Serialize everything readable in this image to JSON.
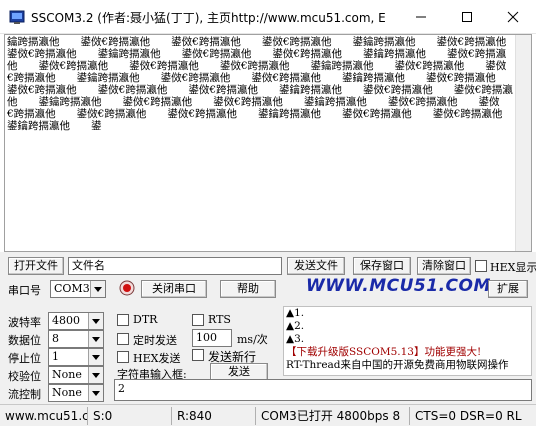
{
  "window": {
    "title": "SSCOM3.2 (作者:聂小猛(丁丁), 主页http://www.mcu51.com,  E..."
  },
  "receive": {
    "text": "鑰跨搹瀛他　　鍙傚€跨搹瀛他　　鍙傚€跨搹瀛他　　鍙傚€跨搹瀛他　　鍙鑰跨搹瀛他　　鍙傚€跨搹瀛他　　鍙傚€跨搹瀛他　　鍙鑰跨搹瀛他　　鍙傚€跨搹瀛他　　鍙傚€跨搹瀛他　　鍙鑰跨搹瀛他　　鍙傚€跨搹瀛他　　鍙傚€跨搹瀛他　　鍙傚€跨搹瀛他　　鍙傚€跨搹瀛他　　鍙鑰跨搹瀛他　　鍙傚€跨搹瀛他　　鍙傚€跨搹瀛他　　鍙鑰跨搹瀛他　　鍙傚€跨搹瀛他　　鍙傚€跨搹瀛他　　鍙鑰跨搹瀛他　　鍙傚€跨搹瀛他　　鍙傚€跨搹瀛他　　鍙傚€跨搹瀛他　　鍙傚€跨搹瀛他　　鍙鑰跨搹瀛他　　鍙傚€跨搹瀛他　　鍙傚€跨搹瀛他　　鍙鑰跨搹瀛他　　鍙傚€跨搹瀛他　　鍙傚€跨搹瀛他　　鍙鑰跨搹瀛他　　鍙傚€跨搹瀛他　　鍙傚€跨搹瀛他　　鍙傚€跨搹瀛他　　鍙傚€跨搹瀛他　　鍙鑰跨搹瀛他　　鍙傚€跨搹瀛他　　鍙傚€跨搹瀛他　　鍙鑰跨搹瀛他　　鍙"
  },
  "toolbar": {
    "open_file": "打开文件",
    "filename_value": "文件名",
    "send_file": "发送文件",
    "save_window": "保存窗口",
    "clear_window": "清除窗口",
    "hex_display": "HEX显示",
    "port_label": "串口号",
    "port_value": "COM3",
    "close_port": "关闭串口",
    "help": "帮助",
    "logo": "WWW.MCU51.COM",
    "expand": "扩展"
  },
  "settings": {
    "baud_label": "波特率",
    "baud_value": "4800",
    "databits_label": "数据位",
    "databits_value": "8",
    "stopbits_label": "停止位",
    "stopbits_value": "1",
    "parity_label": "校验位",
    "parity_value": "None",
    "flow_label": "流控制",
    "flow_value": "None"
  },
  "controls": {
    "dtr": "DTR",
    "rts": "RTS",
    "timed_send": "定时发送",
    "interval_value": "100",
    "interval_unit": "ms/次",
    "hex_send": "HEX发送",
    "send_newline": "发送新行",
    "input_label": "字符串输入框:",
    "send_button": "发送",
    "send_text": "2"
  },
  "info": {
    "line1": "▲1.",
    "line2": "▲2.",
    "line3": "▲3.",
    "line4": "【下载升级版SSCOM5.13】功能更强大!",
    "line5": "RT-Thread来自中国的开源免费商用物联网操作"
  },
  "status": {
    "url": "www.mcu51.com",
    "sent": "S:0",
    "received": "R:840",
    "port_state": "COM3已打开  4800bps  8",
    "signals": "CTS=0 DSR=0 RL"
  },
  "colors": {
    "logo": "#1a2aa8",
    "info_red": "#a00000",
    "panel_bg": "#f0f0f0"
  }
}
